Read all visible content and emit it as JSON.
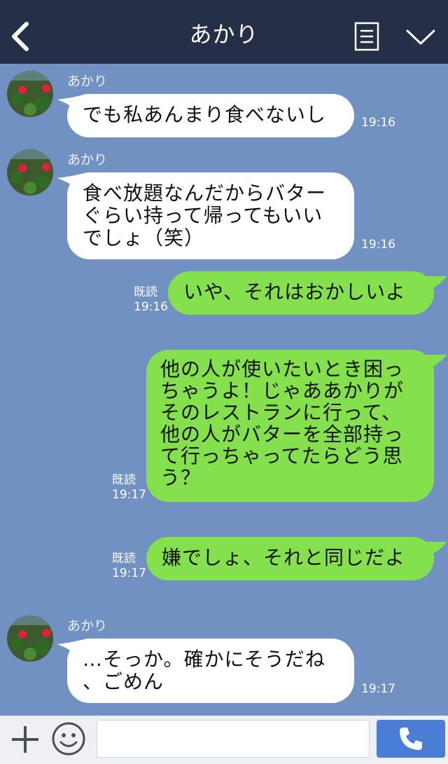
{
  "header": {
    "title": "あかり",
    "icons": [
      "back-arrow-icon",
      "notes-icon",
      "chevron-down-icon"
    ]
  },
  "messages": [
    {
      "side": "in",
      "sender": "あかり",
      "lines": [
        "でも私あんまり食べないし"
      ],
      "time": "19:16"
    },
    {
      "side": "in",
      "sender": "あかり",
      "lines": [
        "食べ放題なんだからバター",
        "ぐらい持って帰ってもいい",
        "でしょ（笑）"
      ],
      "time": "19:16"
    },
    {
      "side": "out",
      "read": "既読",
      "lines": [
        "いや、それはおかしいよ"
      ],
      "time": "19:16"
    },
    {
      "side": "out",
      "read": "既読",
      "lines": [
        "他の人が使いたいとき困っ",
        "ちゃうよ！じゃああかりが",
        "そのレストランに行って、",
        "他の人がバターを全部持っ",
        "て行っちゃってたらどう思",
        "う？"
      ],
      "time": "19:17"
    },
    {
      "side": "out",
      "read": "既読",
      "lines": [
        "嫌でしょ、それと同じだよ"
      ],
      "time": "19:17"
    },
    {
      "side": "in",
      "sender": "あかり",
      "lines": [
        "…そっか。確かにそうだね",
        "、ごめん"
      ],
      "time": "19:17"
    }
  ],
  "footer": {
    "input_value": "",
    "icons": [
      "plus-icon",
      "smile-icon",
      "phone-icon"
    ]
  },
  "colors": {
    "background": "#7091c2",
    "header": "#252f46",
    "incoming_bubble": "#ffffff",
    "outgoing_bubble": "#84e14b",
    "call_button": "#4a7ed6"
  }
}
